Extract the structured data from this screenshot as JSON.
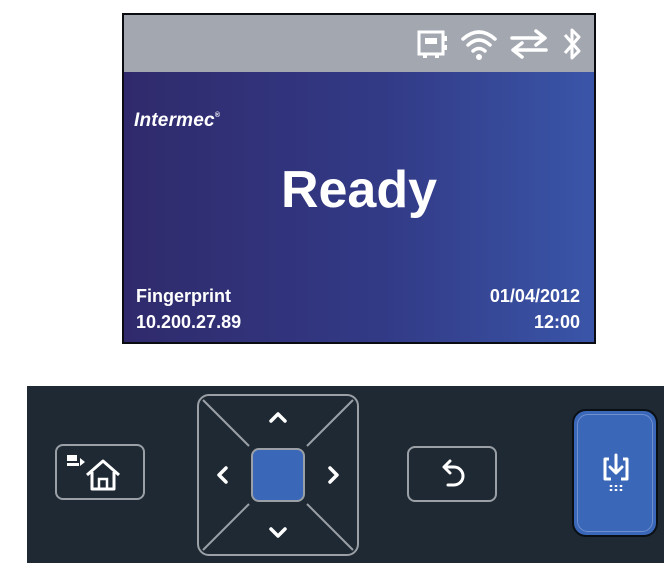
{
  "status_bar": {
    "icons": [
      "network-card-icon",
      "wifi-icon",
      "transfer-arrows-icon",
      "bluetooth-icon"
    ]
  },
  "display": {
    "brand": "Intermec",
    "status": "Ready",
    "mode": "Fingerprint",
    "ip_address": "10.200.27.89",
    "date": "01/04/2012",
    "time": "12:00"
  },
  "keypad": {
    "keys": [
      "home-key",
      "nav-up",
      "nav-down",
      "nav-left",
      "nav-right",
      "ok-key",
      "back-key",
      "feed-key"
    ]
  },
  "colors": {
    "status_bar_bg": "#a3a8b0",
    "display_gradient_start": "#302a6c",
    "display_gradient_end": "#3a55a8",
    "keypad_bg": "#1e2933",
    "accent_blue": "#3a67b8"
  }
}
